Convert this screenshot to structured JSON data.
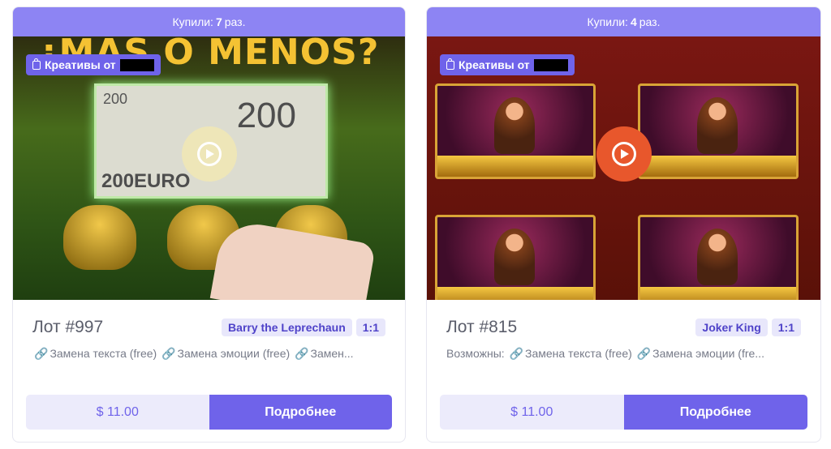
{
  "cards": [
    {
      "bought_prefix": "Купили:",
      "bought_count": "7",
      "bought_suffix": "раз.",
      "tag_label": "Креативы от",
      "art_title": "¿MAS O MENOS?",
      "bill_small": "200",
      "bill_big": "200",
      "bill_bottom": "200EURO",
      "lot": "Лот #997",
      "game": "Barry the Leprechaun",
      "ratio": "1:1",
      "features_prefix": "",
      "features": [
        "Замена текста (free)",
        "Замена эмоции (free)",
        "Замен..."
      ],
      "price": "$ 11.00",
      "more": "Подробнее"
    },
    {
      "bought_prefix": "Купили:",
      "bought_count": "4",
      "bought_suffix": "раз.",
      "tag_label": "Креативы от",
      "lot": "Лот #815",
      "game": "Joker King",
      "ratio": "1:1",
      "features_prefix": "Возможны:",
      "features": [
        "Замена текста (free)",
        "Замена эмоции (fre..."
      ],
      "price": "$ 11.00",
      "more": "Подробнее"
    }
  ],
  "colors": {
    "accent": "#6f63ea",
    "banner": "#8d84f3",
    "chip_bg": "#e8e7fb",
    "play_active": "#e8572c",
    "play_idle": "#f4e9b0"
  },
  "icons": {
    "tag": "shopping-bag-icon",
    "play": "play-icon",
    "feature": "link-icon"
  }
}
